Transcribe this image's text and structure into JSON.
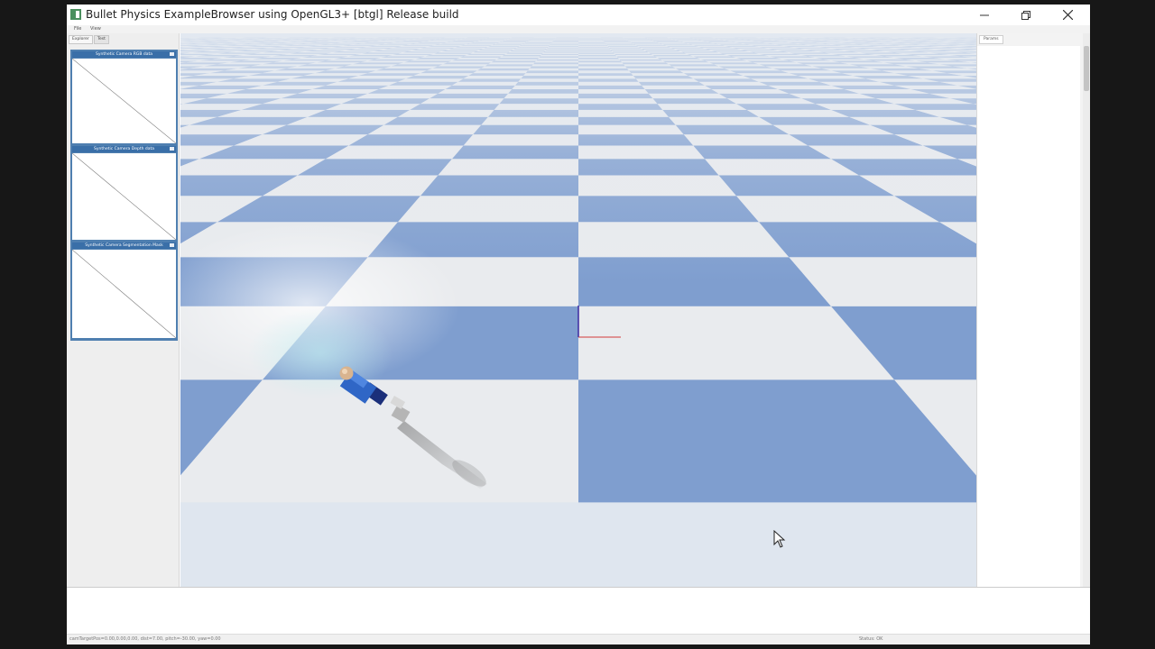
{
  "window": {
    "title": "Bullet Physics ExampleBrowser using OpenGL3+ [btgl] Release build",
    "icon": "bullet-app-icon",
    "controls": [
      "minimize-icon",
      "restore-icon",
      "close-icon"
    ]
  },
  "menu": {
    "items": [
      "File",
      "View"
    ]
  },
  "left_panel": {
    "tabs": [
      "Explorer",
      "Test"
    ],
    "cameras": [
      {
        "label": "Synthetic Camera RGB data"
      },
      {
        "label": "Synthetic Camera Depth data"
      },
      {
        "label": "Synthetic Camera Segmentation Mask"
      }
    ]
  },
  "right_panel": {
    "tab": "Params"
  },
  "status": {
    "left": "camTargetPos=0.00,0.00,0.00, dist=7.00, pitch=-30.00, yaw=0.00",
    "right": "Status: OK"
  },
  "colors": {
    "floor_blue": "#7f9ecf",
    "floor_light": "#e9ebee",
    "robot_blue": "#2f66c6",
    "camera_header": "#3a6fa8"
  }
}
